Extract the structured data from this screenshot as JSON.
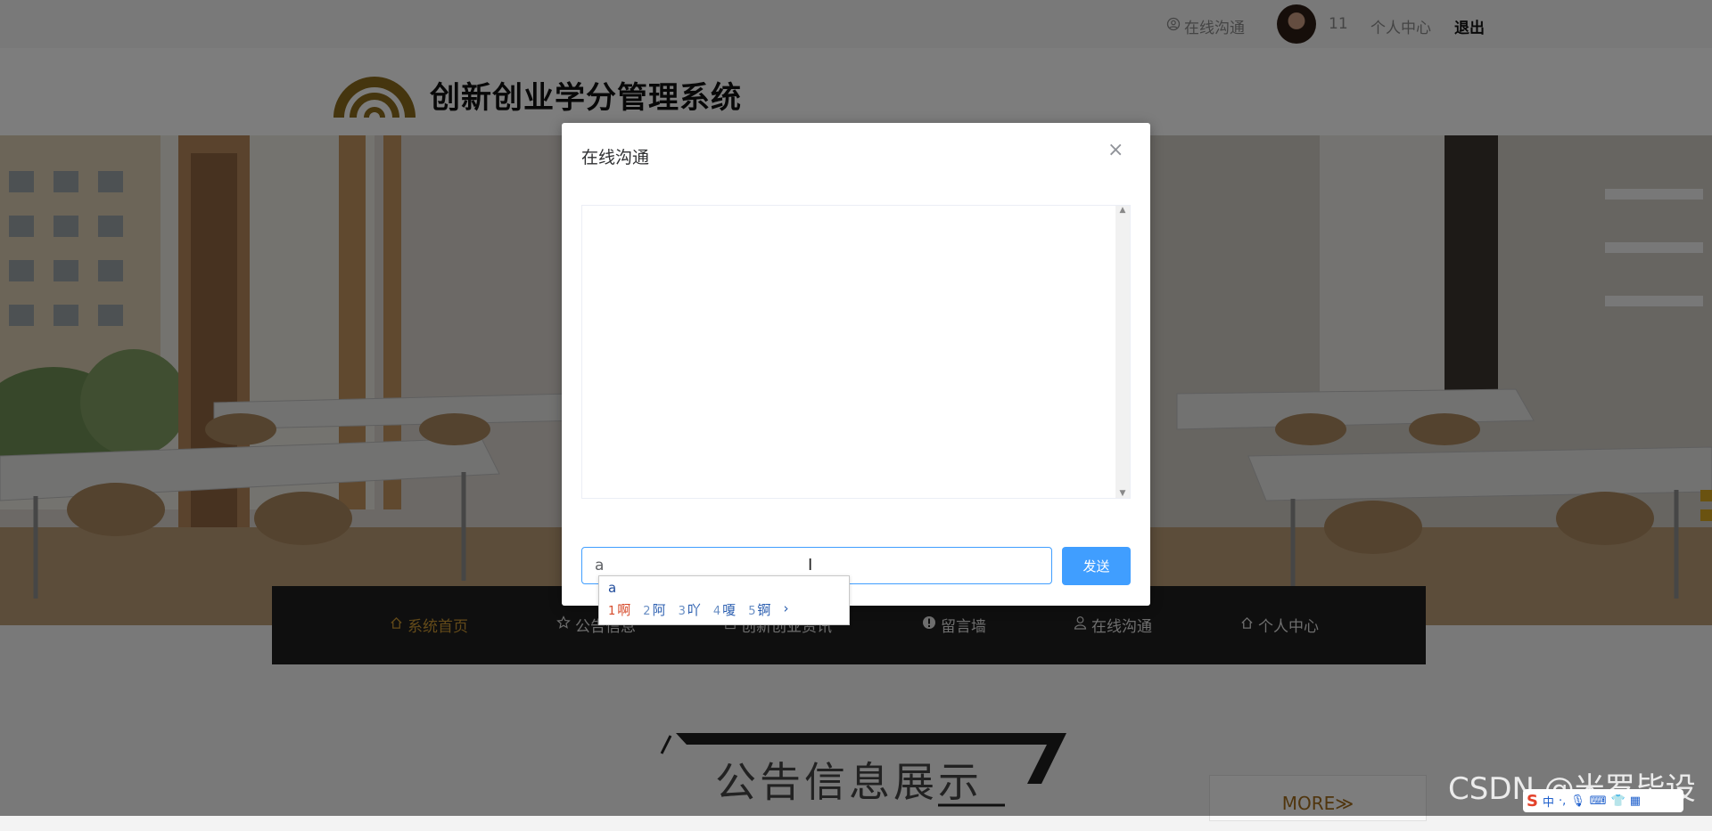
{
  "topbar": {
    "chat_label": "在线沟通",
    "username": "11",
    "user_center": "个人中心",
    "logout": "退出"
  },
  "header": {
    "site_title": "创新创业学分管理系统"
  },
  "nav": {
    "items": [
      {
        "label": "系统首页",
        "icon": "home-icon",
        "active": true
      },
      {
        "label": "公告信息",
        "icon": "star-icon"
      },
      {
        "label": "创新创业资讯",
        "icon": "document-icon"
      },
      {
        "label": "留言墙",
        "icon": "info-icon"
      },
      {
        "label": "在线沟通",
        "icon": "user-icon"
      },
      {
        "label": "个人中心",
        "icon": "home-icon"
      }
    ]
  },
  "notice": {
    "title": "公告信息展示",
    "more": "MORE≫"
  },
  "dialog": {
    "title": "在线沟通",
    "close": "×",
    "input_value": "a",
    "send": "发送"
  },
  "ime": {
    "composition": "a",
    "candidates": [
      {
        "num": "1",
        "text": "啊"
      },
      {
        "num": "2",
        "text": "阿"
      },
      {
        "num": "3",
        "text": "吖"
      },
      {
        "num": "4",
        "text": "嗄"
      },
      {
        "num": "5",
        "text": "锕"
      }
    ],
    "next": "›"
  },
  "watermark": "CSDN @米罗毕设",
  "colors": {
    "accent": "#409eff",
    "nav_active": "#c79532",
    "nav_bg": "#1e1e1e",
    "logo_gold": "#8a6a1c"
  }
}
